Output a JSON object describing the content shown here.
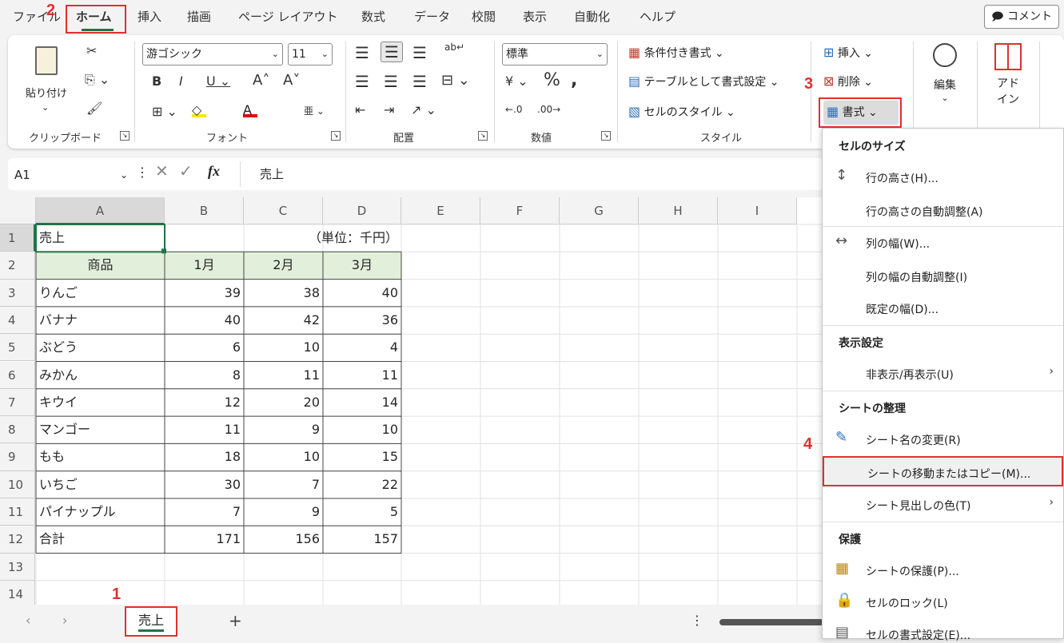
{
  "tabs": [
    "ファイル",
    "ホーム",
    "挿入",
    "描画",
    "ページ レイアウト",
    "数式",
    "データ",
    "校閲",
    "表示",
    "自動化",
    "ヘルプ"
  ],
  "comment_button": "コメント",
  "steps": [
    "1",
    "2",
    "3",
    "4"
  ],
  "ribbon": {
    "clipboard": {
      "paste": "貼り付け",
      "label": "クリップボード"
    },
    "font": {
      "name": "游ゴシック",
      "size": "11",
      "label": "フォント"
    },
    "align": {
      "label": "配置"
    },
    "number": {
      "format": "標準",
      "label": "数値"
    },
    "style": {
      "conditional": "条件付き書式",
      "table": "テーブルとして書式設定",
      "cellstyle": "セルのスタイル",
      "label": "スタイル"
    },
    "cells": {
      "insert": "挿入",
      "delete": "削除",
      "format": "書式"
    },
    "edit": "編集",
    "addin": [
      "アド",
      "イン"
    ]
  },
  "formula": {
    "namebox": "A1",
    "fx": "fx",
    "content": "売上"
  },
  "columns": [
    "A",
    "B",
    "C",
    "D",
    "E",
    "F",
    "G",
    "H",
    "I"
  ],
  "rows": [
    "1",
    "2",
    "3",
    "4",
    "5",
    "6",
    "7",
    "8",
    "9",
    "10",
    "11",
    "12",
    "13",
    "14"
  ],
  "table": {
    "title": "売上",
    "unit": "（単位：千円）",
    "headers": [
      "商品",
      "1月",
      "2月",
      "3月"
    ],
    "data": [
      [
        "りんご",
        "39",
        "38",
        "40"
      ],
      [
        "バナナ",
        "40",
        "42",
        "36"
      ],
      [
        "ぶどう",
        "6",
        "10",
        "4"
      ],
      [
        "みかん",
        "8",
        "11",
        "11"
      ],
      [
        "キウイ",
        "12",
        "20",
        "14"
      ],
      [
        "マンゴー",
        "11",
        "9",
        "10"
      ],
      [
        "もも",
        "18",
        "10",
        "15"
      ],
      [
        "いちご",
        "30",
        "7",
        "22"
      ],
      [
        "パイナップル",
        "7",
        "9",
        "5"
      ],
      [
        "合計",
        "171",
        "156",
        "157"
      ]
    ]
  },
  "sheet_tab": "売上",
  "menu": {
    "h1": "セルのサイズ",
    "row_height": "行の高さ(H)...",
    "row_autofit": "行の高さの自動調整(A)",
    "col_width": "列の幅(W)...",
    "col_autofit": "列の幅の自動調整(I)",
    "default_width": "既定の幅(D)...",
    "h2": "表示設定",
    "hide": "非表示/再表示(U)",
    "h3": "シートの整理",
    "rename": "シート名の変更(R)",
    "move": "シートの移動またはコピー(M)...",
    "tabcolor": "シート見出しの色(T)",
    "h4": "保護",
    "protect": "シートの保護(P)...",
    "lock": "セルのロック(L)",
    "format_cells": "セルの書式設定(E)..."
  },
  "colors": {
    "accent": "#217346",
    "highlight_red": "#e0302f",
    "header_fill": "#e2efda"
  }
}
